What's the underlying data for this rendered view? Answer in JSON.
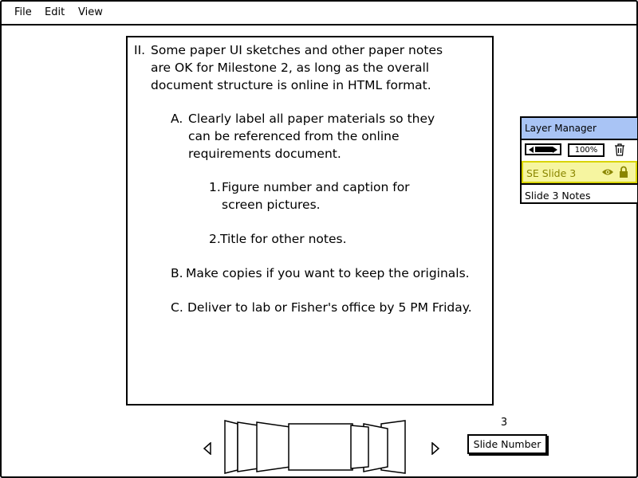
{
  "menu": {
    "file": "File",
    "edit": "Edit",
    "view": "View"
  },
  "slide": {
    "items": {
      "II": {
        "marker": "II.",
        "lines": [
          "Some paper UI sketches and other paper notes",
          "are OK for Milestone 2, as long as the overall",
          "document structure is online in HTML format."
        ]
      },
      "A": {
        "marker": "A.",
        "lines": [
          "Clearly label all paper materials so they",
          "can be referenced from the online",
          "requirements document."
        ]
      },
      "one": {
        "marker": "1.",
        "lines": [
          "Figure number and caption for",
          "screen pictures."
        ]
      },
      "two": {
        "marker": "2.",
        "lines": [
          "Title for other notes."
        ]
      },
      "B": {
        "marker": "B.",
        "lines": [
          "Make copies if you want to keep the originals."
        ]
      },
      "C": {
        "marker": "C.",
        "lines": [
          "Deliver to lab or Fisher's office by 5 PM Friday."
        ]
      }
    }
  },
  "layer_manager": {
    "title": "Layer Manager",
    "zoom": "100%",
    "layers": {
      "selected": "SE Slide 3",
      "notes": "Slide 3 Notes"
    },
    "icons": {
      "trash": "trash-icon",
      "eye": "eye-icon",
      "lock": "lock-icon"
    },
    "colors": {
      "title_bg": "#a9c4f5",
      "selected_bg": "#f6f5a0",
      "selected_border": "#d9d400",
      "icon_color": "#8a8600"
    }
  },
  "slide_nav": {
    "current_number": "3",
    "button_label": "Slide Number"
  }
}
